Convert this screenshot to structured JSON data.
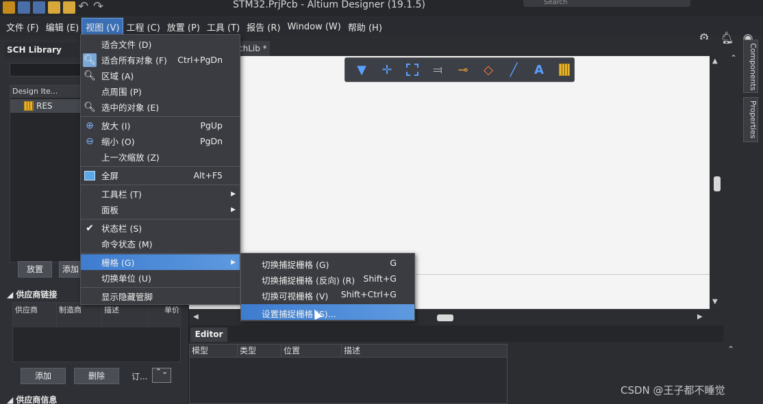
{
  "window": {
    "title": "STM32.PrjPcb - Altium Designer (19.1.5)",
    "search_placeholder": "Search"
  },
  "menubar": [
    {
      "label": "文件 (F)"
    },
    {
      "label": "编辑 (E)"
    },
    {
      "label": "视图 (V)"
    },
    {
      "label": "工程 (C)"
    },
    {
      "label": "放置 (P)"
    },
    {
      "label": "工具 (T)"
    },
    {
      "label": "报告 (R)"
    },
    {
      "label": "Window (W)"
    },
    {
      "label": "帮助 (H)"
    }
  ],
  "left_panel": {
    "title": "SCH Library",
    "list_header": "Design Ite...",
    "items": [
      {
        "label": "RES"
      }
    ],
    "place_button": "放置",
    "add_button_partial": "添加",
    "supplier_links_section": "供应商链接",
    "table_headers": [
      "供应商",
      "制造商",
      "描述",
      "单价"
    ],
    "add_button": "添加",
    "delete_button": "删除",
    "order_label": "订...",
    "stepper_glyph": "⌃⌄",
    "supplier_info_section": "供应商信息"
  },
  "document": {
    "tab_label": "chLib *"
  },
  "right_rail": {
    "components": "Components",
    "properties": "Properties"
  },
  "editor": {
    "tab_label": "Editor",
    "columns": [
      "模型",
      "类型",
      "位置",
      "描述"
    ]
  },
  "view_menu": {
    "items": [
      {
        "label": "适合文件 (D)",
        "shortcut": ""
      },
      {
        "label": "适合所有对象 (F)",
        "shortcut": "Ctrl+PgDn"
      },
      {
        "label": "区域 (A)",
        "shortcut": ""
      },
      {
        "label": "点周围 (P)",
        "shortcut": ""
      },
      {
        "label": "选中的对象 (E)",
        "shortcut": ""
      },
      {
        "label": "放大 (I)",
        "shortcut": "PgUp"
      },
      {
        "label": "缩小 (O)",
        "shortcut": "PgDn"
      },
      {
        "label": "上一次缩放 (Z)",
        "shortcut": ""
      },
      {
        "label": "全屏",
        "shortcut": "Alt+F5"
      },
      {
        "label": "工具栏 (T)",
        "shortcut": ""
      },
      {
        "label": "面板",
        "shortcut": ""
      },
      {
        "label": "状态栏 (S)",
        "shortcut": ""
      },
      {
        "label": "命令状态 (M)",
        "shortcut": ""
      },
      {
        "label": "栅格 (G)",
        "shortcut": ""
      },
      {
        "label": "切换单位 (U)",
        "shortcut": ""
      },
      {
        "label": "显示隐藏管脚",
        "shortcut": ""
      }
    ]
  },
  "grid_submenu": {
    "items": [
      {
        "label": "切换捕捉栅格 (G)",
        "shortcut": "G"
      },
      {
        "label": "切换捕捉栅格 (反向) (R)",
        "shortcut": "Shift+G"
      },
      {
        "label": "切换可视栅格 (V)",
        "shortcut": "Shift+Ctrl+G"
      },
      {
        "label": "设置捕捉栅格 (S)...",
        "shortcut": ""
      }
    ]
  },
  "watermark": "CSDN @王子都不睡觉",
  "colors": {
    "highlight": "#3e7ccf",
    "menu_bg": "#3b3c41",
    "canvas": "#f4f4f4"
  }
}
